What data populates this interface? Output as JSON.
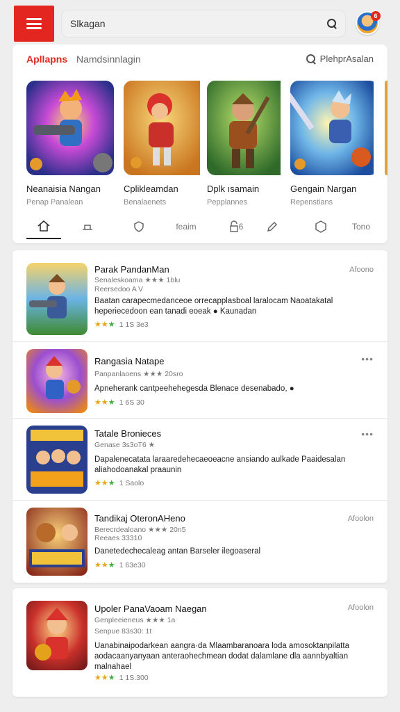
{
  "topbar": {
    "search_text": "Slkagan",
    "avatar_badge": "6"
  },
  "featured": {
    "tab_active": "Apllapns",
    "tab_inactive": "Namdsinnlagin",
    "search_label": "PlehprAsalan",
    "items": [
      {
        "title": "Neanaisia Nangan",
        "subtitle": "Penap Panalean"
      },
      {
        "title": "Cplikleamdan",
        "subtitle": "Benalaenets"
      },
      {
        "title": "Dplk ısamain",
        "subtitle": "Pepplannes"
      },
      {
        "title": "Gengain Nargan",
        "subtitle": "Repenstians"
      }
    ],
    "nav": [
      {
        "icon": "home-icon",
        "label": ""
      },
      {
        "icon": "tray-icon",
        "label": ""
      },
      {
        "icon": "shield-icon",
        "label": ""
      },
      {
        "icon": "",
        "label": "feaim"
      },
      {
        "icon": "lock-icon",
        "label": "6"
      },
      {
        "icon": "pencil-icon",
        "label": ""
      },
      {
        "icon": "hexagon-icon",
        "label": ""
      },
      {
        "icon": "",
        "label": "Tono"
      }
    ]
  },
  "list": [
    {
      "title": "Parak PandanMan",
      "meta1": "Senaleskoama ★★★ 1blu",
      "meta2": "Reersedoo A V",
      "desc": "Baatan carapecmedanceoe orrecapplasboal laralocam Naoatakatal heperiecedoon ean tanadi eoeak ● Kaunadan",
      "rating": "1 1S 3e3",
      "right": "Afoono"
    },
    {
      "title": "Rangasia Natape",
      "meta1": "Panpanlaoens ★★★ 20sro",
      "meta2": "",
      "desc": "Apneherank cantpeehehegesda Blenace desenabado, ●",
      "rating": "1 6S 30",
      "right": "•••"
    },
    {
      "title": "Tatale Bronieces",
      "meta1": "Genase 3s3oT6 ★",
      "meta2": "",
      "desc": "Dapalenecatata laraaredehecaeoeacne ansiando aulkade Paaidesalan aliahodoanakal praaunin",
      "rating": "1 Saolo",
      "right": "•••"
    },
    {
      "title": "Tandikaj OteronAHeno",
      "meta1": "Berecrdealoano ★★★ 20n5",
      "meta2": "Reeaes 33310",
      "desc": "Danetedechecaleag antan Barseler ilegoaseral",
      "rating": "1 63e30",
      "right": "Afoolon"
    }
  ],
  "bottom": {
    "title": "Upoler PanaVaoam Naegan",
    "meta1": "Genpleeieneus ★★★ 1a",
    "meta2": "Senpue 83s30: 1t",
    "desc": "Uanabinaipodarkean aangra·da Mlaambaranoara loda amosoktanpilatta aodacaanyanyaan anteraohechmean dodat dalamlane dla aannbyaltian malnahael",
    "rating": "1 1S.300",
    "right": "Afoolon"
  },
  "colors": {
    "brand_red": "#e3261f",
    "star_gold": "#e7a418",
    "star_green": "#3fae3c"
  }
}
